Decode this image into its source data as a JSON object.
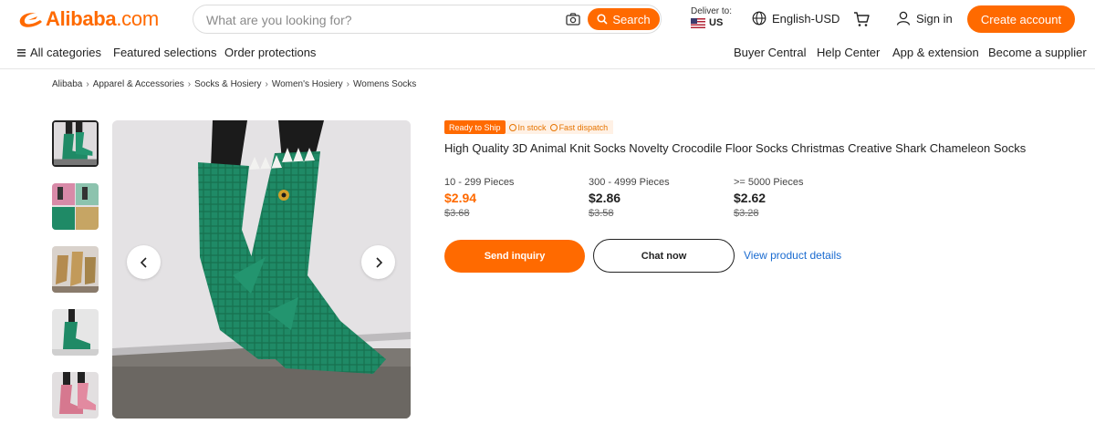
{
  "header": {
    "brand": "Alibaba",
    "brand_suffix": ".com",
    "search_placeholder": "What are you looking for?",
    "search_button": "Search",
    "deliver_label": "Deliver to:",
    "deliver_country": "US",
    "language": "English-USD",
    "sign_in": "Sign in",
    "create_account": "Create account"
  },
  "nav": {
    "left": [
      "All categories",
      "Featured selections",
      "Order protections"
    ],
    "right": [
      "Buyer Central",
      "Help Center",
      "App & extension",
      "Become a supplier"
    ]
  },
  "breadcrumb": [
    "Alibaba",
    "Apparel & Accessories",
    "Socks & Hosiery",
    "Women's Hosiery",
    "Womens Socks"
  ],
  "product": {
    "badge_ready": "Ready to Ship",
    "badge_stock": "In stock",
    "badge_dispatch": "Fast dispatch",
    "title": "High Quality 3D Animal Knit Socks Novelty Crocodile Floor Socks Christmas Creative Shark Chameleon Socks",
    "tiers": [
      {
        "qty": "10 - 299 Pieces",
        "price": "$2.94",
        "old": "$3.68"
      },
      {
        "qty": "300 - 4999 Pieces",
        "price": "$2.86",
        "old": "$3.58"
      },
      {
        "qty": ">= 5000 Pieces",
        "price": "$2.62",
        "old": "$3.28"
      }
    ],
    "send_inquiry": "Send inquiry",
    "chat_now": "Chat now",
    "view_details": "View product details"
  },
  "colors": {
    "accent": "#ff6a00",
    "link": "#1a6bd0",
    "sock_green": "#1f8a66"
  }
}
